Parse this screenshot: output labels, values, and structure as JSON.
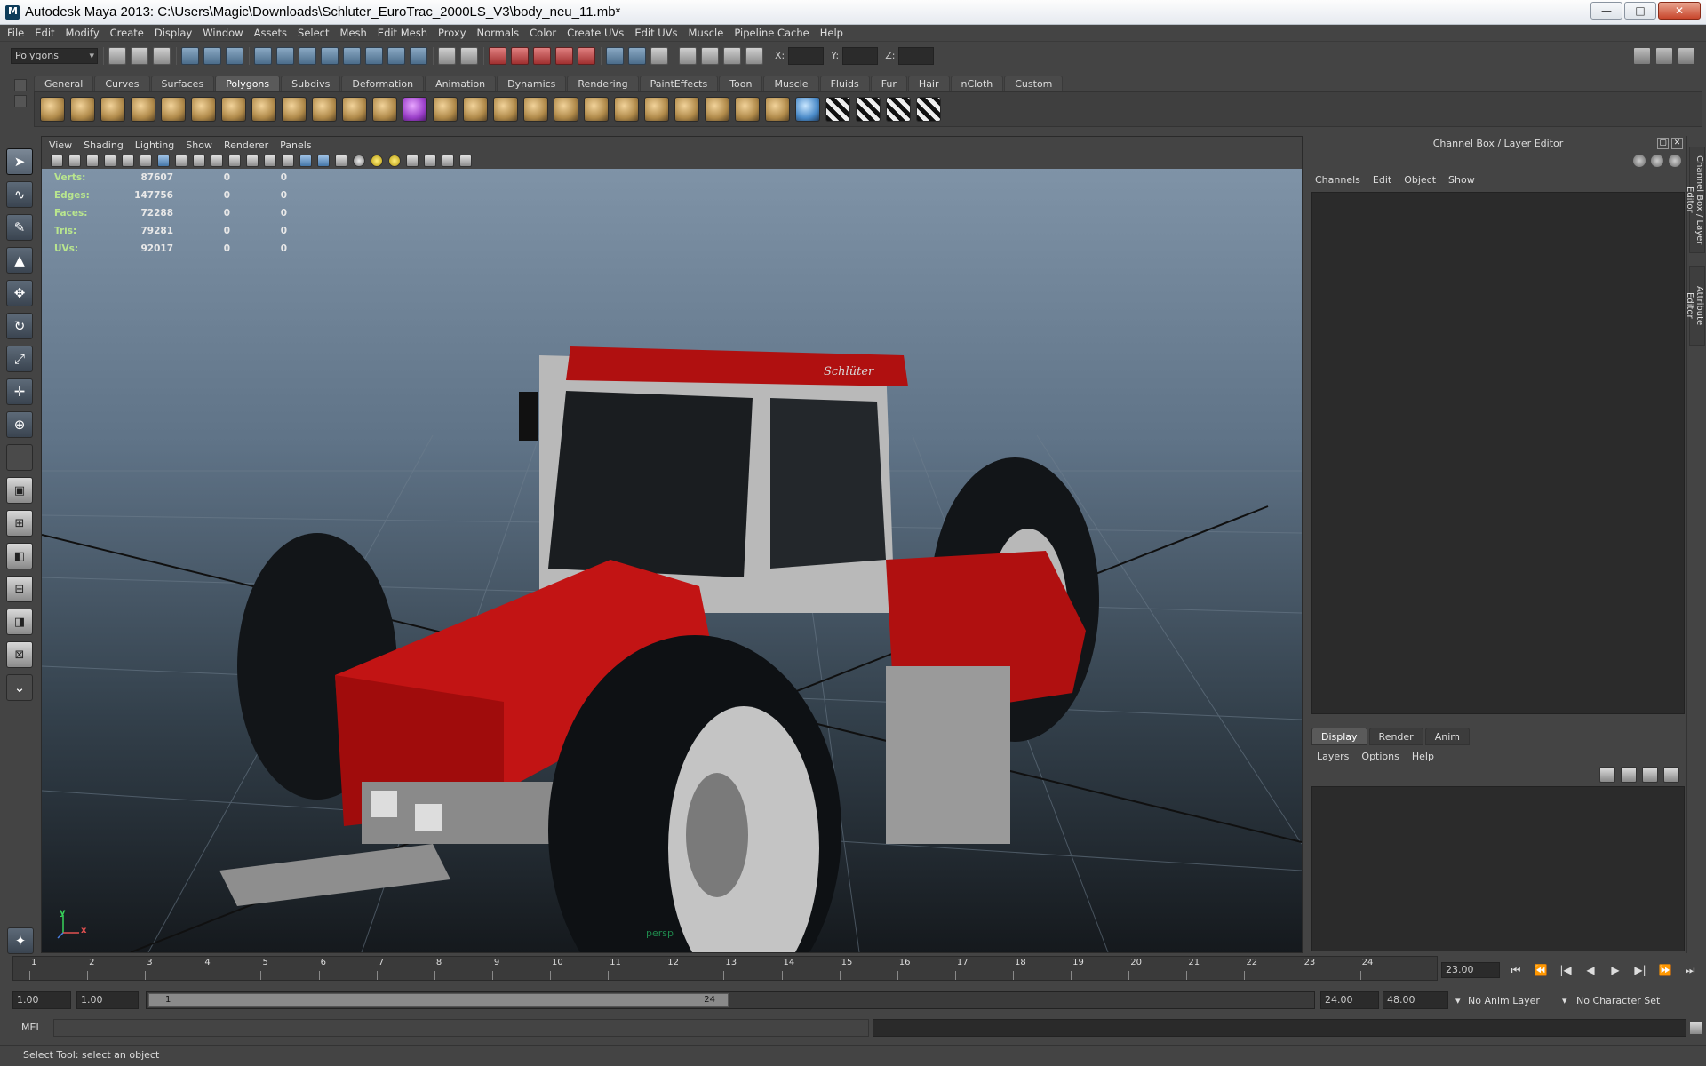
{
  "window": {
    "title": "Autodesk Maya 2013: C:\\Users\\Magic\\Downloads\\Schluter_EuroTrac_2000LS_V3\\body_neu_11.mb*",
    "minimize": "—",
    "maximize": "□",
    "close": "✕"
  },
  "menubar": [
    "File",
    "Edit",
    "Modify",
    "Create",
    "Display",
    "Window",
    "Assets",
    "Select",
    "Mesh",
    "Edit Mesh",
    "Proxy",
    "Normals",
    "Color",
    "Create UVs",
    "Edit UVs",
    "Muscle",
    "Pipeline Cache",
    "Help"
  ],
  "statusline": {
    "mode": "Polygons",
    "x_label": "X:",
    "y_label": "Y:",
    "z_label": "Z:"
  },
  "shelf": {
    "tabs": [
      "General",
      "Curves",
      "Surfaces",
      "Polygons",
      "Subdivs",
      "Deformation",
      "Animation",
      "Dynamics",
      "Rendering",
      "PaintEffects",
      "Toon",
      "Muscle",
      "Fluids",
      "Fur",
      "Hair",
      "nCloth",
      "Custom"
    ],
    "active_tab": "Polygons",
    "item_count": 30
  },
  "viewport": {
    "menu": [
      "View",
      "Shading",
      "Lighting",
      "Show",
      "Renderer",
      "Panels"
    ],
    "camera": "persp",
    "hud": [
      {
        "label": "Verts:",
        "value": "87607",
        "sel": "0",
        "comp": "0"
      },
      {
        "label": "Edges:",
        "value": "147756",
        "sel": "0",
        "comp": "0"
      },
      {
        "label": "Faces:",
        "value": "72288",
        "sel": "0",
        "comp": "0"
      },
      {
        "label": "Tris:",
        "value": "79281",
        "sel": "0",
        "comp": "0"
      },
      {
        "label": "UVs:",
        "value": "92017",
        "sel": "0",
        "comp": "0"
      }
    ],
    "axis": {
      "y": "y",
      "x": "x",
      "z": "z"
    },
    "model_text": "Schlüter"
  },
  "channel_box": {
    "title": "Channel Box / Layer Editor",
    "menu": [
      "Channels",
      "Edit",
      "Object",
      "Show"
    ],
    "layer_tabs": [
      "Display",
      "Render",
      "Anim"
    ],
    "active_layer_tab": "Display",
    "layer_menu": [
      "Layers",
      "Options",
      "Help"
    ]
  },
  "side_tabs": [
    "Channel Box / Layer Editor",
    "Attribute Editor"
  ],
  "timeline": {
    "frames": [
      "1",
      "2",
      "3",
      "4",
      "5",
      "6",
      "7",
      "8",
      "9",
      "10",
      "11",
      "12",
      "13",
      "14",
      "15",
      "16",
      "17",
      "18",
      "19",
      "20",
      "21",
      "22",
      "23",
      "24"
    ],
    "current_frame": "23.00",
    "playback_buttons": [
      "⏮",
      "⏪",
      "|◀",
      "◀",
      "▶",
      "▶|",
      "⏩",
      "⏭"
    ]
  },
  "range": {
    "start": "1.00",
    "playback_start": "1.00",
    "slider_start": "1",
    "slider_end": "24",
    "playback_end": "24.00",
    "end": "48.00",
    "anim_layer": "No Anim Layer",
    "character_set": "No Character Set"
  },
  "command": {
    "label": "MEL"
  },
  "help_line": "Select Tool: select an object"
}
